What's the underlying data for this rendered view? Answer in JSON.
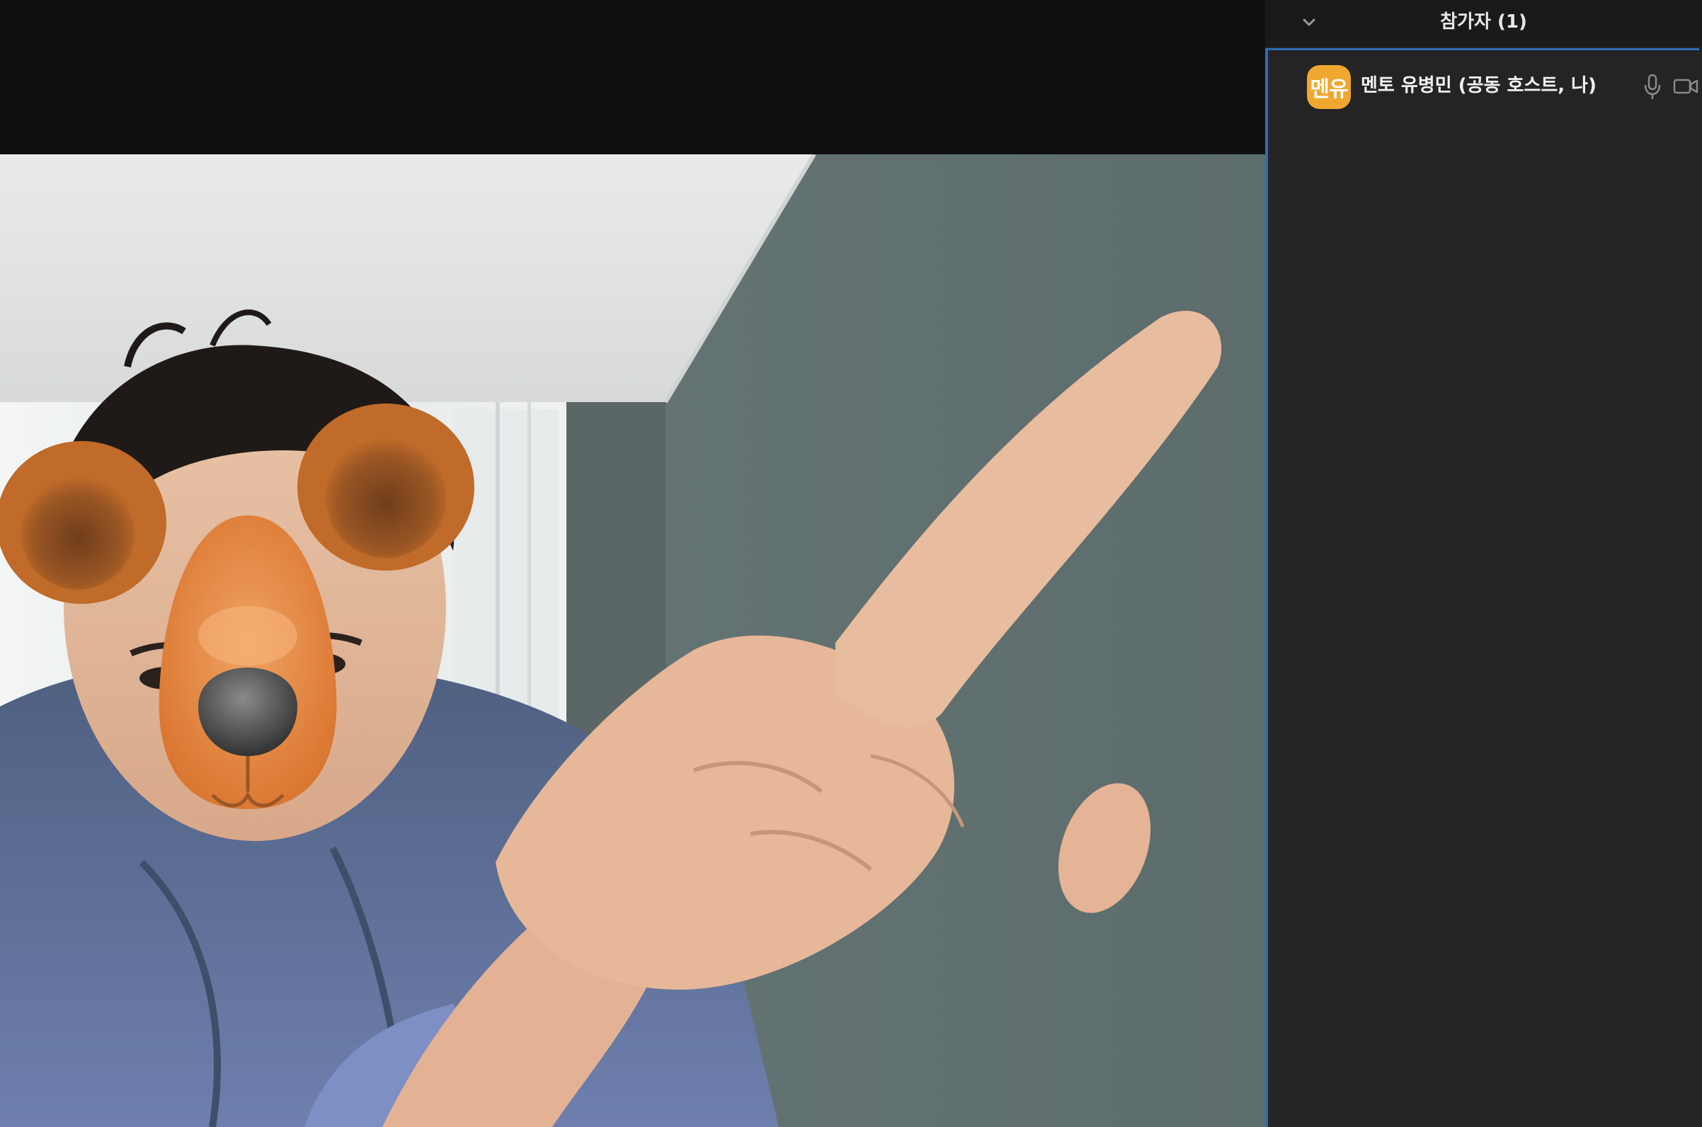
{
  "participants_panel": {
    "title": "참가자 (1)",
    "collapse_icon": "chevron-down-icon",
    "participants": [
      {
        "avatar_text": "멘유",
        "avatar_color": "#f0a730",
        "name": "멘토 유병민 (공동 호스트, 나)",
        "mic_icon": "microphone-icon",
        "camera_icon": "video-camera-icon"
      }
    ]
  },
  "video": {
    "filter": "bear-face-filter"
  },
  "colors": {
    "panel_bg": "#242424",
    "header_bg": "#1a1a1a",
    "selection_border": "#2e6db3",
    "video_top_bg": "#101010"
  }
}
